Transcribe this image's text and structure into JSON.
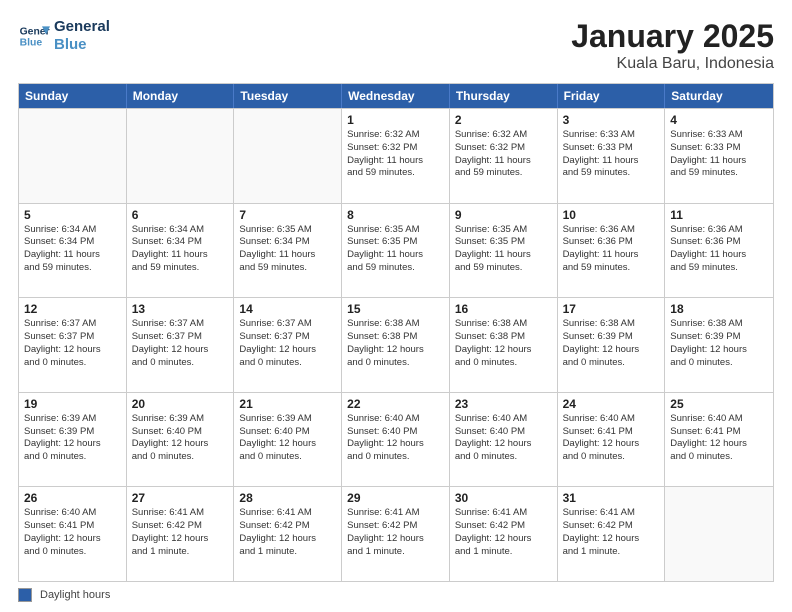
{
  "app": {
    "logo_line1": "General",
    "logo_line2": "Blue"
  },
  "title": "January 2025",
  "subtitle": "Kuala Baru, Indonesia",
  "days_of_week": [
    "Sunday",
    "Monday",
    "Tuesday",
    "Wednesday",
    "Thursday",
    "Friday",
    "Saturday"
  ],
  "footer": {
    "legend_label": "Daylight hours"
  },
  "weeks": [
    [
      {
        "num": "",
        "info": ""
      },
      {
        "num": "",
        "info": ""
      },
      {
        "num": "",
        "info": ""
      },
      {
        "num": "1",
        "info": "Sunrise: 6:32 AM\nSunset: 6:32 PM\nDaylight: 11 hours\nand 59 minutes."
      },
      {
        "num": "2",
        "info": "Sunrise: 6:32 AM\nSunset: 6:32 PM\nDaylight: 11 hours\nand 59 minutes."
      },
      {
        "num": "3",
        "info": "Sunrise: 6:33 AM\nSunset: 6:33 PM\nDaylight: 11 hours\nand 59 minutes."
      },
      {
        "num": "4",
        "info": "Sunrise: 6:33 AM\nSunset: 6:33 PM\nDaylight: 11 hours\nand 59 minutes."
      }
    ],
    [
      {
        "num": "5",
        "info": "Sunrise: 6:34 AM\nSunset: 6:34 PM\nDaylight: 11 hours\nand 59 minutes."
      },
      {
        "num": "6",
        "info": "Sunrise: 6:34 AM\nSunset: 6:34 PM\nDaylight: 11 hours\nand 59 minutes."
      },
      {
        "num": "7",
        "info": "Sunrise: 6:35 AM\nSunset: 6:34 PM\nDaylight: 11 hours\nand 59 minutes."
      },
      {
        "num": "8",
        "info": "Sunrise: 6:35 AM\nSunset: 6:35 PM\nDaylight: 11 hours\nand 59 minutes."
      },
      {
        "num": "9",
        "info": "Sunrise: 6:35 AM\nSunset: 6:35 PM\nDaylight: 11 hours\nand 59 minutes."
      },
      {
        "num": "10",
        "info": "Sunrise: 6:36 AM\nSunset: 6:36 PM\nDaylight: 11 hours\nand 59 minutes."
      },
      {
        "num": "11",
        "info": "Sunrise: 6:36 AM\nSunset: 6:36 PM\nDaylight: 11 hours\nand 59 minutes."
      }
    ],
    [
      {
        "num": "12",
        "info": "Sunrise: 6:37 AM\nSunset: 6:37 PM\nDaylight: 12 hours\nand 0 minutes."
      },
      {
        "num": "13",
        "info": "Sunrise: 6:37 AM\nSunset: 6:37 PM\nDaylight: 12 hours\nand 0 minutes."
      },
      {
        "num": "14",
        "info": "Sunrise: 6:37 AM\nSunset: 6:37 PM\nDaylight: 12 hours\nand 0 minutes."
      },
      {
        "num": "15",
        "info": "Sunrise: 6:38 AM\nSunset: 6:38 PM\nDaylight: 12 hours\nand 0 minutes."
      },
      {
        "num": "16",
        "info": "Sunrise: 6:38 AM\nSunset: 6:38 PM\nDaylight: 12 hours\nand 0 minutes."
      },
      {
        "num": "17",
        "info": "Sunrise: 6:38 AM\nSunset: 6:39 PM\nDaylight: 12 hours\nand 0 minutes."
      },
      {
        "num": "18",
        "info": "Sunrise: 6:38 AM\nSunset: 6:39 PM\nDaylight: 12 hours\nand 0 minutes."
      }
    ],
    [
      {
        "num": "19",
        "info": "Sunrise: 6:39 AM\nSunset: 6:39 PM\nDaylight: 12 hours\nand 0 minutes."
      },
      {
        "num": "20",
        "info": "Sunrise: 6:39 AM\nSunset: 6:40 PM\nDaylight: 12 hours\nand 0 minutes."
      },
      {
        "num": "21",
        "info": "Sunrise: 6:39 AM\nSunset: 6:40 PM\nDaylight: 12 hours\nand 0 minutes."
      },
      {
        "num": "22",
        "info": "Sunrise: 6:40 AM\nSunset: 6:40 PM\nDaylight: 12 hours\nand 0 minutes."
      },
      {
        "num": "23",
        "info": "Sunrise: 6:40 AM\nSunset: 6:40 PM\nDaylight: 12 hours\nand 0 minutes."
      },
      {
        "num": "24",
        "info": "Sunrise: 6:40 AM\nSunset: 6:41 PM\nDaylight: 12 hours\nand 0 minutes."
      },
      {
        "num": "25",
        "info": "Sunrise: 6:40 AM\nSunset: 6:41 PM\nDaylight: 12 hours\nand 0 minutes."
      }
    ],
    [
      {
        "num": "26",
        "info": "Sunrise: 6:40 AM\nSunset: 6:41 PM\nDaylight: 12 hours\nand 0 minutes."
      },
      {
        "num": "27",
        "info": "Sunrise: 6:41 AM\nSunset: 6:42 PM\nDaylight: 12 hours\nand 1 minute."
      },
      {
        "num": "28",
        "info": "Sunrise: 6:41 AM\nSunset: 6:42 PM\nDaylight: 12 hours\nand 1 minute."
      },
      {
        "num": "29",
        "info": "Sunrise: 6:41 AM\nSunset: 6:42 PM\nDaylight: 12 hours\nand 1 minute."
      },
      {
        "num": "30",
        "info": "Sunrise: 6:41 AM\nSunset: 6:42 PM\nDaylight: 12 hours\nand 1 minute."
      },
      {
        "num": "31",
        "info": "Sunrise: 6:41 AM\nSunset: 6:42 PM\nDaylight: 12 hours\nand 1 minute."
      },
      {
        "num": "",
        "info": ""
      }
    ]
  ]
}
